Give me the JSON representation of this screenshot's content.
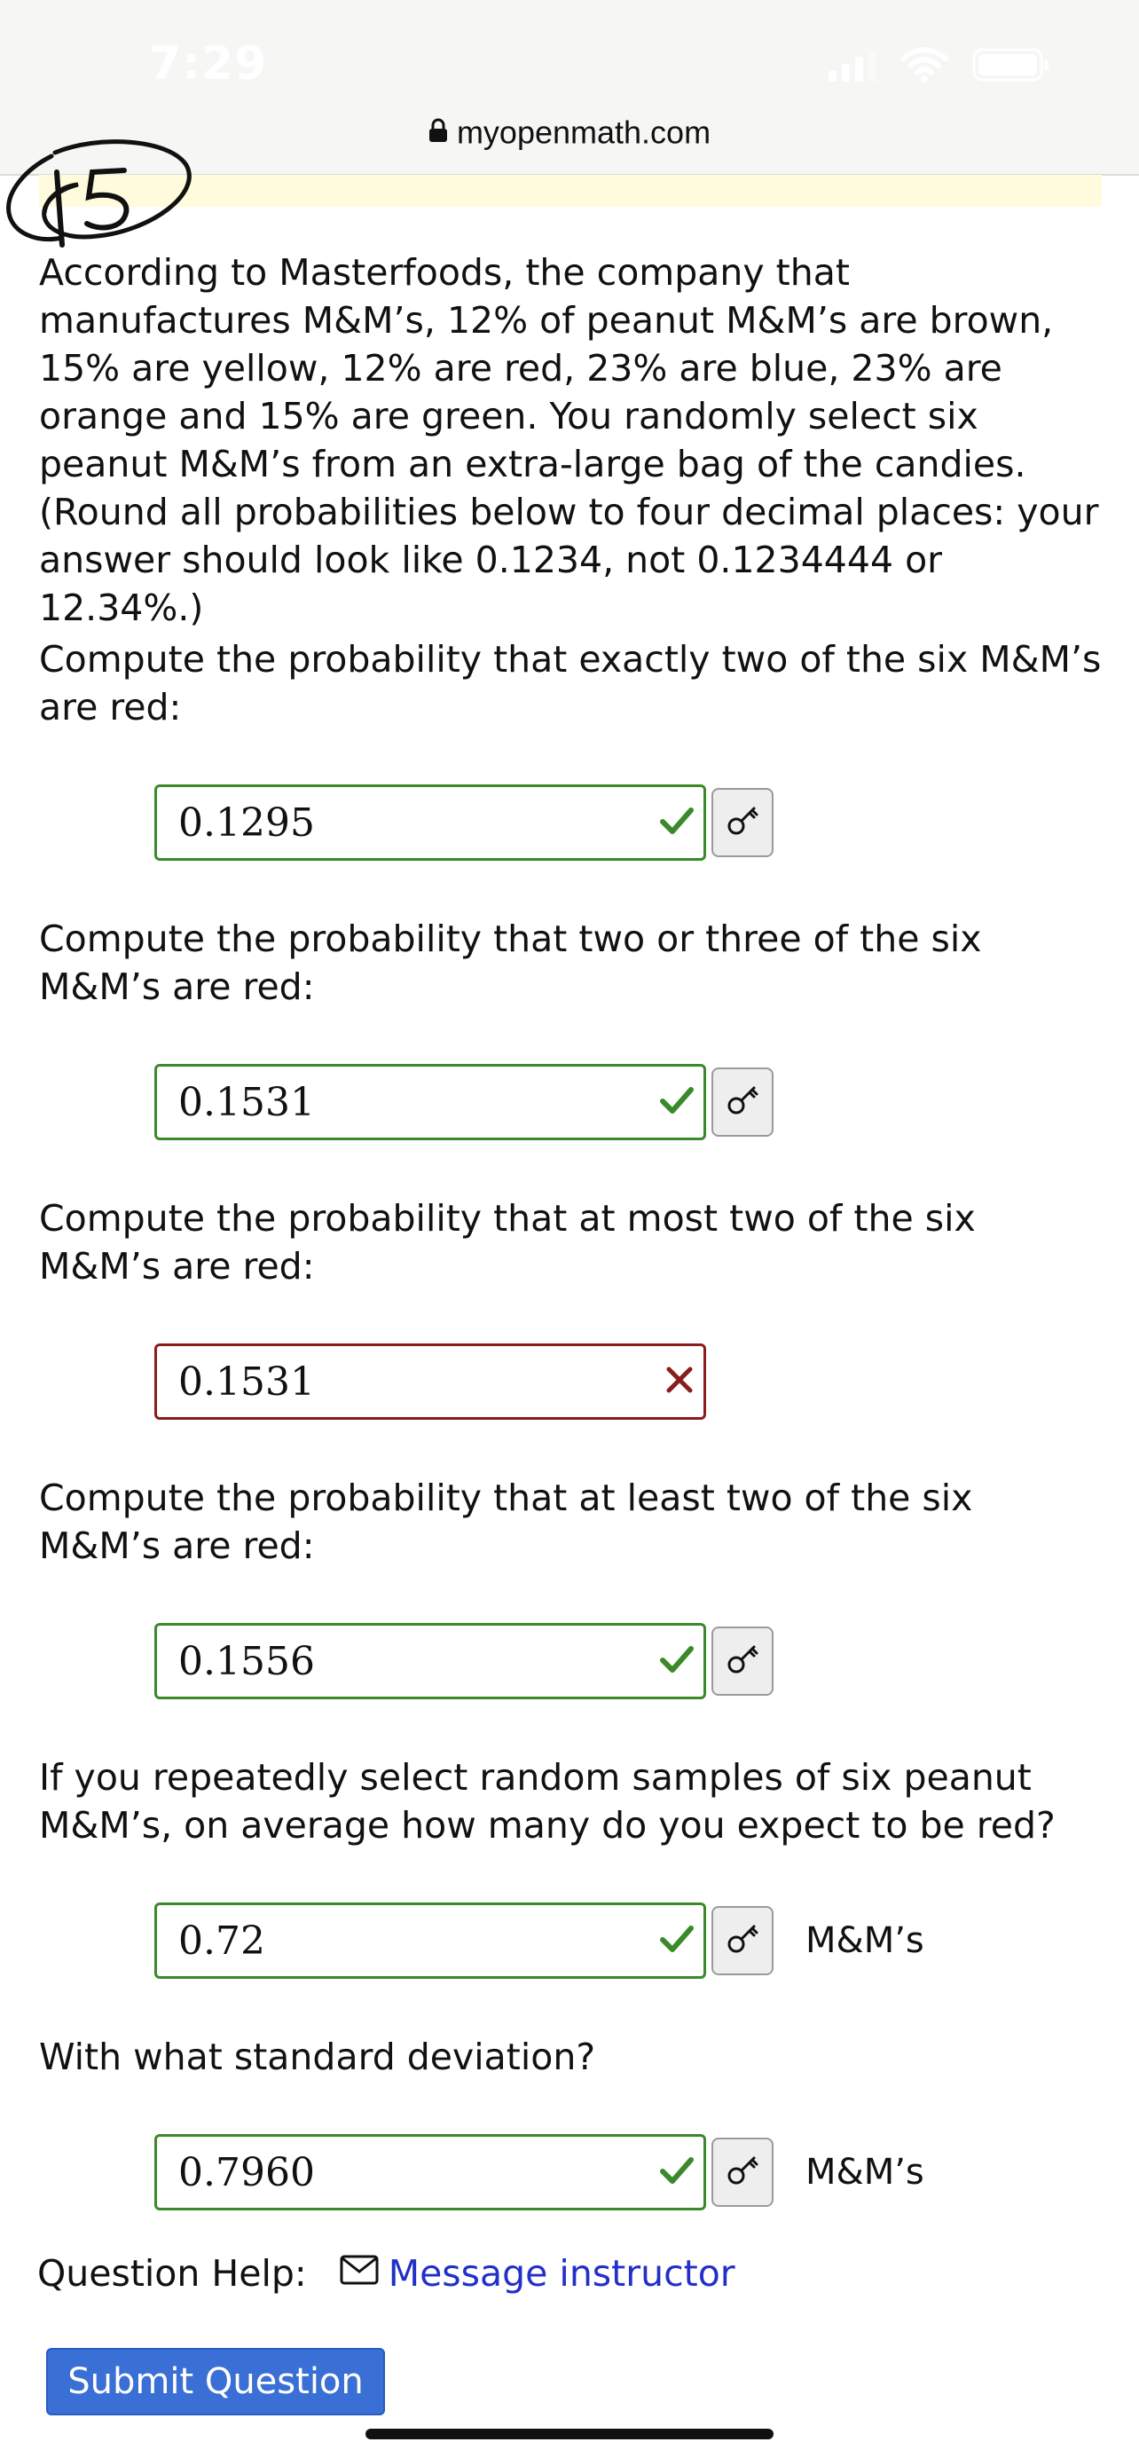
{
  "status_bar": {
    "time": "7:29",
    "icons": [
      "signal-icon",
      "wifi-icon",
      "battery-icon"
    ]
  },
  "browser": {
    "url": "myopenmath.com",
    "lock_icon": "lock-icon"
  },
  "annotation": {
    "handwritten_label": "15"
  },
  "problem": {
    "intro": "According to Masterfoods, the company that manufactures M&M’s, 12% of peanut M&M’s are brown, 15% are yellow, 12% are red, 23% are blue, 23% are orange and 15% are green. You randomly select six peanut M&M’s from an extra-large bag of the candies. (Round all probabilities below to four decimal places: your answer should look like 0.1234, not 0.1234444 or 12.34%.)"
  },
  "questions": [
    {
      "prompt": "Compute the probability that exactly two of the six M&M’s are red:",
      "answer": "0.1295",
      "status": "correct",
      "unit": ""
    },
    {
      "prompt": "Compute the probability that two or three of the six M&M’s are red:",
      "answer": "0.1531",
      "status": "correct",
      "unit": ""
    },
    {
      "prompt": "Compute the probability that at most two of the six M&M’s are red:",
      "answer": "0.1531",
      "status": "incorrect",
      "unit": ""
    },
    {
      "prompt": "Compute the probability that at least two of the six M&M’s are red:",
      "answer": "0.1556",
      "status": "correct",
      "unit": ""
    },
    {
      "prompt": "If you repeatedly select random samples of six peanut M&M’s, on average how many do you expect to be red?",
      "answer": "0.72",
      "status": "correct",
      "unit": "M&M’s"
    },
    {
      "prompt": "With what standard deviation?",
      "answer": "0.7960",
      "status": "correct",
      "unit": "M&M’s"
    }
  ],
  "help": {
    "label": "Question Help:",
    "link": "Message instructor"
  },
  "submit_label": "Submit Question",
  "colors": {
    "correct": "#3a8a2a",
    "incorrect": "#8a1c1c",
    "link": "#2230c8",
    "submit": "#3a6fd6"
  }
}
